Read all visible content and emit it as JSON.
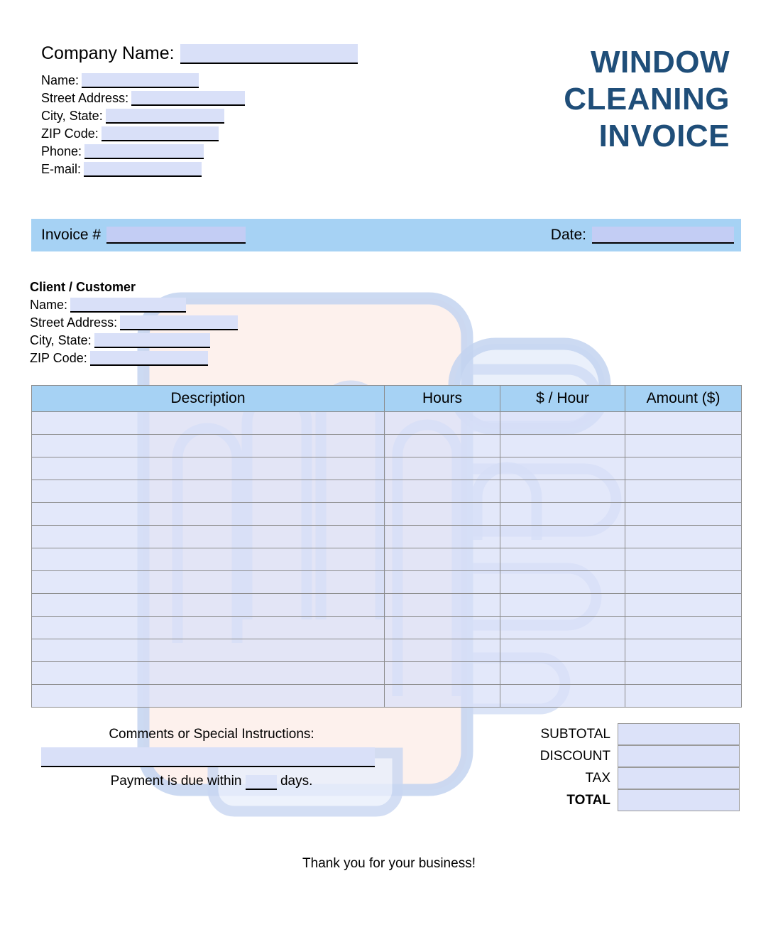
{
  "document": {
    "title_lines": [
      "WINDOW",
      "CLEANING",
      "INVOICE"
    ],
    "title_color": "#1f4e79",
    "accent_bar_color": "#a6d2f4",
    "field_fill_color": "#d9e0f8"
  },
  "company": {
    "company_name_label": "Company Name:",
    "fields": [
      {
        "label": "Name:",
        "value": "",
        "fill_width": 165
      },
      {
        "label": "Street Address:",
        "value": "",
        "fill_width": 160
      },
      {
        "label": "City, State:",
        "value": "",
        "fill_width": 167
      },
      {
        "label": "ZIP Code:",
        "value": "",
        "fill_width": 165
      },
      {
        "label": "Phone:",
        "value": "",
        "fill_width": 168
      },
      {
        "label": "E-mail:",
        "value": "",
        "fill_width": 166
      }
    ]
  },
  "invoice_bar": {
    "invoice_number_label": "Invoice #",
    "invoice_number_value": "",
    "date_label": "Date:",
    "date_value": ""
  },
  "client": {
    "heading": "Client / Customer",
    "fields": [
      {
        "label": "Name:",
        "value": "",
        "fill_width": 163
      },
      {
        "label": "Street Address:",
        "value": "",
        "fill_width": 166
      },
      {
        "label": "City, State:",
        "value": "",
        "fill_width": 163
      },
      {
        "label": "ZIP Code:",
        "value": "",
        "fill_width": 166
      }
    ]
  },
  "items_table": {
    "columns": [
      "Description",
      "Hours",
      "$ / Hour",
      "Amount ($)"
    ],
    "row_count": 13,
    "rows": [
      {
        "description": "",
        "hours": "",
        "rate": "",
        "amount": ""
      },
      {
        "description": "",
        "hours": "",
        "rate": "",
        "amount": ""
      },
      {
        "description": "",
        "hours": "",
        "rate": "",
        "amount": ""
      },
      {
        "description": "",
        "hours": "",
        "rate": "",
        "amount": ""
      },
      {
        "description": "",
        "hours": "",
        "rate": "",
        "amount": ""
      },
      {
        "description": "",
        "hours": "",
        "rate": "",
        "amount": ""
      },
      {
        "description": "",
        "hours": "",
        "rate": "",
        "amount": ""
      },
      {
        "description": "",
        "hours": "",
        "rate": "",
        "amount": ""
      },
      {
        "description": "",
        "hours": "",
        "rate": "",
        "amount": ""
      },
      {
        "description": "",
        "hours": "",
        "rate": "",
        "amount": ""
      },
      {
        "description": "",
        "hours": "",
        "rate": "",
        "amount": ""
      },
      {
        "description": "",
        "hours": "",
        "rate": "",
        "amount": ""
      },
      {
        "description": "",
        "hours": "",
        "rate": "",
        "amount": ""
      }
    ]
  },
  "comments": {
    "label": "Comments or Special Instructions:",
    "value": "",
    "payment_terms_prefix": "Payment is due within",
    "payment_terms_days": "",
    "payment_terms_suffix": "days."
  },
  "totals": {
    "rows": [
      {
        "label": "SUBTOTAL",
        "value": "",
        "bold": false
      },
      {
        "label": "DISCOUNT",
        "value": "",
        "bold": false
      },
      {
        "label": "TAX",
        "value": "",
        "bold": false
      },
      {
        "label": "TOTAL",
        "value": "",
        "bold": true
      }
    ]
  },
  "footer": {
    "thank_you": "Thank you for your business!"
  }
}
